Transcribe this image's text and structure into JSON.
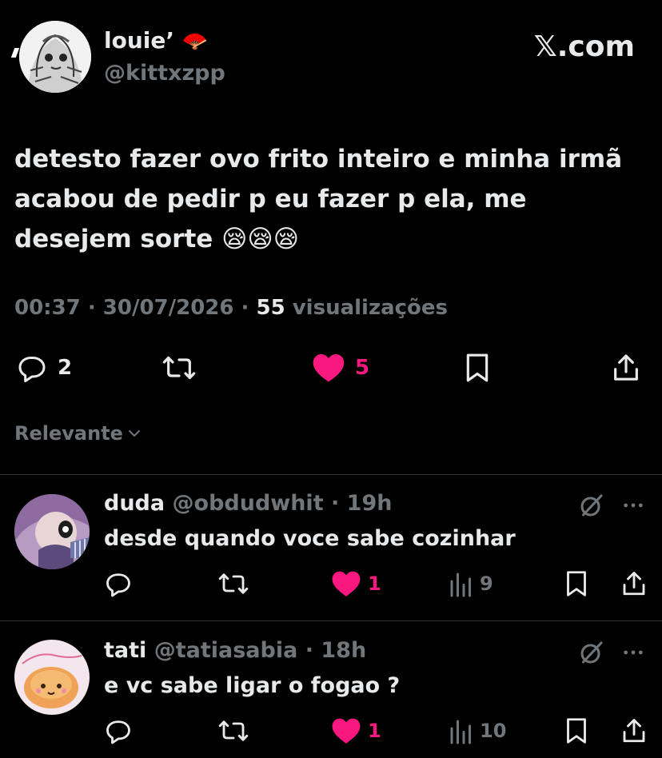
{
  "tweet": {
    "author": {
      "name": "louie’",
      "name_emoji": "🪭",
      "handle": "@kittxzpp"
    },
    "brand": "𝕏.com",
    "text": "detesto fazer ovo frito inteiro e minha irmã acabou de pedir p eu fazer p ela, me desejem sorte 😪😪😪",
    "time": "00:37",
    "date": "30/07/2026",
    "views_count": "55",
    "views_label": "visualizações",
    "actions": {
      "replies": "2",
      "likes": "5"
    },
    "like_color": "#f91880"
  },
  "sort": {
    "label": "Relevante"
  },
  "replies": [
    {
      "name": "duda",
      "handle": "@obdudwhit",
      "age": "19h",
      "text": "desde quando voce sabe cozinhar",
      "likes": "1",
      "views": "9"
    },
    {
      "name": "tati",
      "handle": "@tatiasabia",
      "age": "18h",
      "text": "e vc sabe ligar o fogao ?",
      "likes": "1",
      "views": "10"
    }
  ],
  "icons": [
    "reply-icon",
    "retweet-icon",
    "heart-icon",
    "bookmark-icon",
    "share-icon",
    "views-icon",
    "grok-icon",
    "more-icon",
    "chevron-down-icon"
  ]
}
